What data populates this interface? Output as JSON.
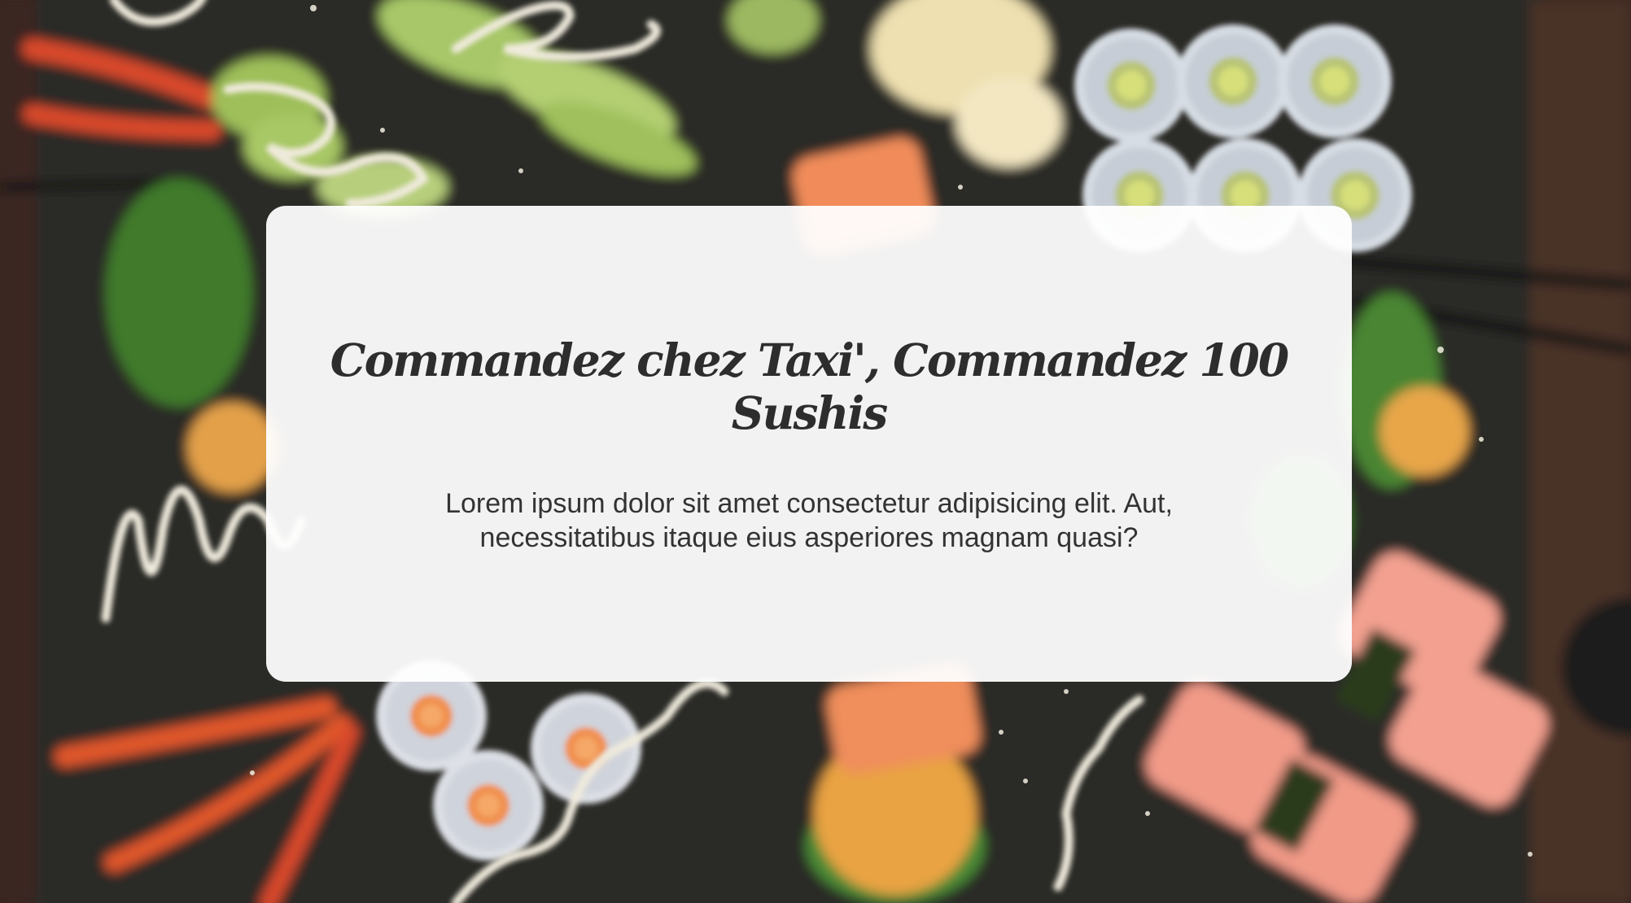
{
  "hero": {
    "background": "blurred-sushi-platter-photo",
    "card": {
      "title": "Commandez chez Taxi', Commandez 100 Sushis",
      "description": "Lorem ipsum dolor sit amet consectetur adipisicing elit. Aut, necessitatibus itaque eius asperiores magnam quasi?"
    }
  },
  "colors": {
    "slate": "#2a2624",
    "card": "#ffffff",
    "title_text": "#2d2d2d",
    "body_text": "#333333"
  }
}
